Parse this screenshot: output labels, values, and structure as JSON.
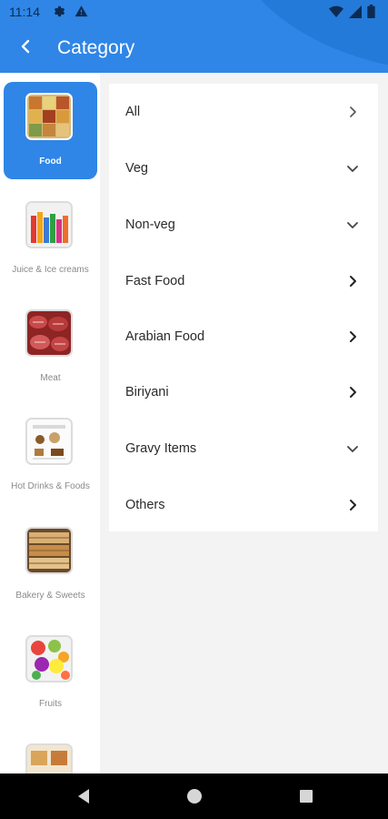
{
  "status_bar": {
    "time": "11:14",
    "left_icons": [
      "gear-icon",
      "warning-icon"
    ],
    "right_icons": [
      "wifi-icon",
      "signal-icon",
      "battery-icon"
    ]
  },
  "app_bar": {
    "title": "Category",
    "back_icon": "back-arrow-icon",
    "background": "#2f86e6"
  },
  "categories": [
    {
      "label": "Food",
      "selected": true,
      "image": "food-thumbnail"
    },
    {
      "label": "Juice & Ice creams",
      "selected": false,
      "image": "juice-thumbnail"
    },
    {
      "label": "Meat",
      "selected": false,
      "image": "meat-thumbnail"
    },
    {
      "label": "Hot Drinks & Foods",
      "selected": false,
      "image": "hot-drinks-thumbnail"
    },
    {
      "label": "Bakery & Sweets",
      "selected": false,
      "image": "bakery-thumbnail"
    },
    {
      "label": "Fruits",
      "selected": false,
      "image": "fruits-thumbnail"
    }
  ],
  "subcategories": [
    {
      "label": "All",
      "icon": "chevron-right-icon"
    },
    {
      "label": "Veg",
      "icon": "chevron-down-icon"
    },
    {
      "label": "Non-veg",
      "icon": "chevron-down-icon"
    },
    {
      "label": "Fast Food",
      "icon": "chevron-right-icon"
    },
    {
      "label": "Arabian Food",
      "icon": "chevron-right-icon"
    },
    {
      "label": "Biriyani",
      "icon": "chevron-right-icon"
    },
    {
      "label": "Gravy Items",
      "icon": "chevron-down-icon"
    },
    {
      "label": "Others",
      "icon": "chevron-right-icon"
    }
  ],
  "nav_bar": {
    "buttons": [
      "back-triangle-icon",
      "home-circle-icon",
      "recents-square-icon"
    ]
  },
  "colors": {
    "accent": "#2f86e6",
    "background": "#f3f3f3",
    "card": "#ffffff"
  }
}
